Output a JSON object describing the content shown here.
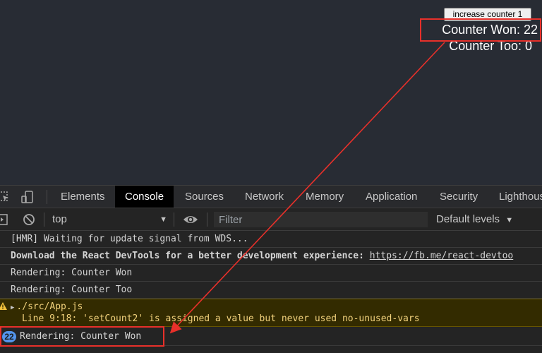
{
  "app": {
    "button_label": "increase counter 1",
    "counter_won": "Counter Won: 22",
    "counter_too": "Counter Too: 0"
  },
  "devtools": {
    "tabs": [
      {
        "label": "Elements",
        "active": false
      },
      {
        "label": "Console",
        "active": true
      },
      {
        "label": "Sources",
        "active": false
      },
      {
        "label": "Network",
        "active": false
      },
      {
        "label": "Memory",
        "active": false
      },
      {
        "label": "Application",
        "active": false
      },
      {
        "label": "Security",
        "active": false
      },
      {
        "label": "Lighthous",
        "active": false
      }
    ],
    "context": "top",
    "filter_placeholder": "Filter",
    "levels_label": "Default levels"
  },
  "console": {
    "lines": [
      {
        "text": "[HMR] Waiting for update signal from WDS..."
      },
      {
        "text": "Download the React DevTools for a better development experience: ",
        "link": "https://fb.me/react-devtoo"
      },
      {
        "text": "Rendering:  Counter Won"
      },
      {
        "text": "Rendering:  Counter Too"
      }
    ],
    "warning": {
      "file": "./src/App.js",
      "message": "Line 9:18:  'setCount2' is assigned a value but never used  no-unused-vars"
    },
    "last": {
      "count": "22",
      "text": "Rendering:  Counter Won"
    }
  },
  "colors": {
    "highlight": "#e8302a",
    "badge": "#5394ec",
    "warning_bg": "#332b00"
  }
}
